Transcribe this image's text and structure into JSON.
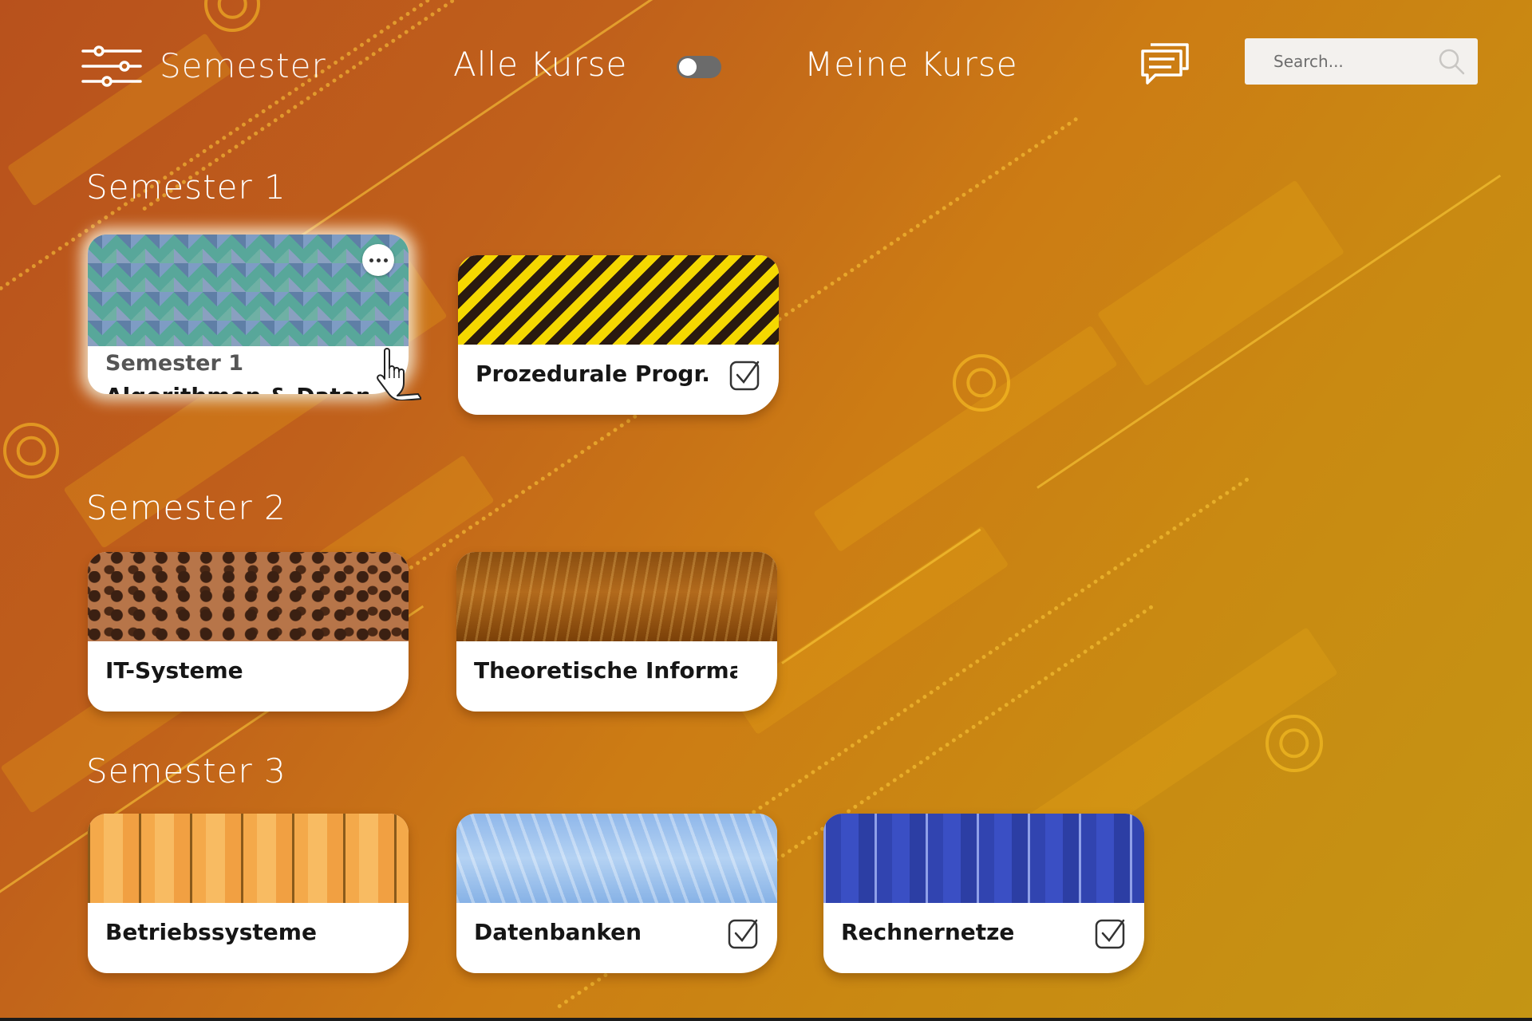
{
  "header": {
    "filter_label": "Semester",
    "all_courses_label": "Alle Kurse",
    "my_courses_label": "Meine Kurse",
    "toggle_state": "off",
    "search_placeholder": "Search...",
    "icons": [
      "filter-sliders-icon",
      "chat-messages-icon",
      "search-icon"
    ]
  },
  "sections": [
    {
      "title": "Semester 1",
      "courses": [
        {
          "subtitle": "Semester 1",
          "title": "Algorithmen & Datenstr",
          "pattern": "cubes",
          "selected": true,
          "checked": false,
          "has_more_menu": true
        },
        {
          "title": "Prozedurale Progr.",
          "pattern": "hazard",
          "checked": true
        }
      ]
    },
    {
      "title": "Semester 2",
      "courses": [
        {
          "title": "IT-Systeme",
          "pattern": "leopard",
          "checked": false
        },
        {
          "title": "Theoretische Informati",
          "pattern": "bronze",
          "checked": false
        }
      ]
    },
    {
      "title": "Semester 3",
      "courses": [
        {
          "title": "Betriebssysteme",
          "pattern": "wood",
          "checked": false
        },
        {
          "title": "Datenbanken",
          "pattern": "water",
          "checked": true
        },
        {
          "title": "Rechnernetze",
          "pattern": "bluewood",
          "checked": true
        }
      ]
    }
  ],
  "colors": {
    "background_start": "#b8511c",
    "background_end": "#c49514",
    "accent_ring": "#ffc828",
    "card_bg": "#ffffff",
    "text_white": "#ffffff"
  }
}
